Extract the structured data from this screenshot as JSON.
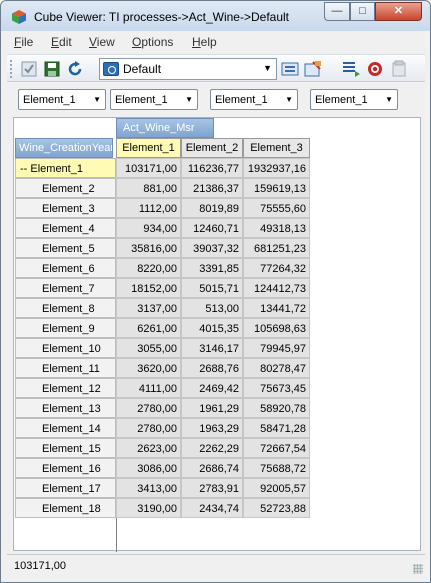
{
  "window": {
    "title": "Cube Viewer: TI processes->Act_Wine->Default"
  },
  "menu": [
    {
      "u": "F",
      "rest": "ile"
    },
    {
      "u": "E",
      "rest": "dit"
    },
    {
      "u": "V",
      "rest": "iew"
    },
    {
      "u": "O",
      "rest": "ptions"
    },
    {
      "u": "H",
      "rest": "elp"
    }
  ],
  "toolbar": {
    "view_select": "Default",
    "icons": [
      "recalculate-icon",
      "save-icon",
      "refresh-icon",
      "export-icon",
      "slice-icon",
      "suppress-zeros-icon",
      "stop-icon",
      "settings-icon"
    ]
  },
  "dimension_selectors": [
    "Element_1",
    "Element_1",
    "Element_1",
    "Element_1"
  ],
  "grid": {
    "column_dimension": "Act_Wine_Msr",
    "row_dimension": "Wine_CreationYear",
    "columns": [
      "Element_1",
      "Element_2",
      "Element_3"
    ],
    "rows": [
      {
        "label": "-- Element_1",
        "values": [
          "103171,00",
          "116236,77",
          "1932937,16"
        ]
      },
      {
        "label": "Element_2",
        "values": [
          "881,00",
          "21386,37",
          "159619,13"
        ]
      },
      {
        "label": "Element_3",
        "values": [
          "1112,00",
          "8019,89",
          "75555,60"
        ]
      },
      {
        "label": "Element_4",
        "values": [
          "934,00",
          "12460,71",
          "49318,13"
        ]
      },
      {
        "label": "Element_5",
        "values": [
          "35816,00",
          "39037,32",
          "681251,23"
        ]
      },
      {
        "label": "Element_6",
        "values": [
          "8220,00",
          "3391,85",
          "77264,32"
        ]
      },
      {
        "label": "Element_7",
        "values": [
          "18152,00",
          "5015,71",
          "124412,73"
        ]
      },
      {
        "label": "Element_8",
        "values": [
          "3137,00",
          "513,00",
          "13441,72"
        ]
      },
      {
        "label": "Element_9",
        "values": [
          "6261,00",
          "4015,35",
          "105698,63"
        ]
      },
      {
        "label": "Element_10",
        "values": [
          "3055,00",
          "3146,17",
          "79945,97"
        ]
      },
      {
        "label": "Element_11",
        "values": [
          "3620,00",
          "2688,76",
          "80278,47"
        ]
      },
      {
        "label": "Element_12",
        "values": [
          "4111,00",
          "2469,42",
          "75673,45"
        ]
      },
      {
        "label": "Element_13",
        "values": [
          "2780,00",
          "1961,29",
          "58920,78"
        ]
      },
      {
        "label": "Element_14",
        "values": [
          "2780,00",
          "1963,29",
          "58471,28"
        ]
      },
      {
        "label": "Element_15",
        "values": [
          "2623,00",
          "2262,29",
          "72667,54"
        ]
      },
      {
        "label": "Element_16",
        "values": [
          "3086,00",
          "2686,74",
          "75688,72"
        ]
      },
      {
        "label": "Element_17",
        "values": [
          "3413,00",
          "2783,91",
          "92005,57"
        ]
      },
      {
        "label": "Element_18",
        "values": [
          "3190,00",
          "2434,74",
          "52723,88"
        ]
      }
    ]
  },
  "status": {
    "value": "103171,00"
  }
}
